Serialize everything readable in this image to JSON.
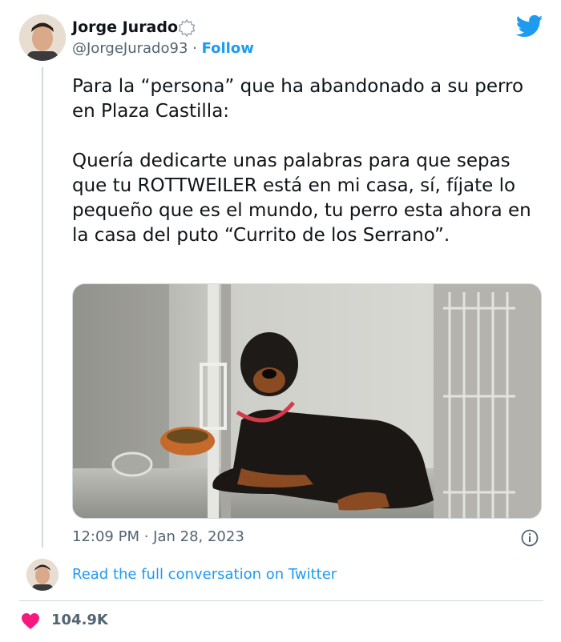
{
  "author": {
    "name": "Jorge Jurado",
    "handle": "@JorgeJurado93",
    "separator": " · ",
    "follow_label": "Follow"
  },
  "tweet": {
    "paragraphs": [
      "Para la “persona” que ha abandonado a su perro en Plaza Castilla:",
      "Quería dedicarte unas palabras para que sepas que tu ROTTWEILER está en mi casa, sí, fíjate lo pequeño que es el mundo, tu perro esta ahora en la casa del puto “Currito de los Serrano”."
    ],
    "timestamp": "12:09 PM · Jan 28, 2023"
  },
  "conversation": {
    "link_label": "Read the full conversation on Twitter"
  },
  "engagement": {
    "likes": "104.9K"
  },
  "icons": {
    "verified": "verified-badge-icon",
    "logo": "twitter-bird-icon",
    "info": "info-icon",
    "like": "heart-icon"
  },
  "colors": {
    "accent": "#1d9bf0",
    "heart": "#f91880",
    "secondary_text": "#536471",
    "border": "#cfd9de"
  }
}
